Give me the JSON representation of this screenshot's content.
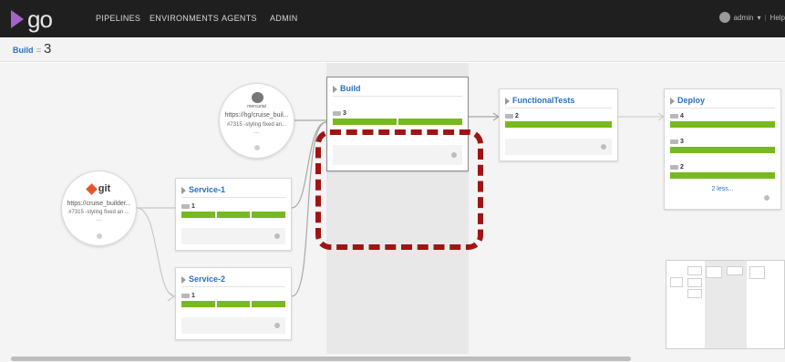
{
  "header": {
    "logo_text": "go",
    "nav": [
      "PIPELINES",
      "ENVIRONMENTS",
      "AGENTS",
      "ADMIN"
    ],
    "user": "admin",
    "user_caret": "▾",
    "separator": "|",
    "help": "Help"
  },
  "breadcrumb": {
    "pipeline": "Build",
    "separator": "=",
    "counter": "3"
  },
  "materials": [
    {
      "id": "git",
      "logo_text": "git",
      "url": "https://cruise_builder...",
      "message": "#7315 -styling fixed an ...",
      "more": "..."
    },
    {
      "id": "hg",
      "logo_text": "mercurial",
      "url": "https://hg/cruise_buil...",
      "message": "#7315 -styling fixed an...",
      "more": "..."
    }
  ],
  "pipelines": [
    {
      "id": "service-1",
      "name": "Service-1",
      "instances": [
        {
          "label": "1",
          "stages": 3
        }
      ]
    },
    {
      "id": "service-2",
      "name": "Service-2",
      "instances": [
        {
          "label": "1",
          "stages": 3
        }
      ]
    },
    {
      "id": "build",
      "name": "Build",
      "instances": [
        {
          "label": "3",
          "stages": 2
        }
      ]
    },
    {
      "id": "functionaltests",
      "name": "FunctionalTests",
      "instances": [
        {
          "label": "2",
          "stages": 1
        }
      ]
    },
    {
      "id": "deploy",
      "name": "Deploy",
      "instances": [
        {
          "label": "4",
          "stages": 1
        },
        {
          "label": "3",
          "stages": 1
        },
        {
          "label": "2",
          "stages": 1
        }
      ],
      "more_label": "2 less..."
    }
  ],
  "colors": {
    "stage_passed": "#77b91e",
    "link": "#2a70c3",
    "highlight": "#a01414",
    "topbar": "#1f1f1f",
    "git": "#e4572e",
    "logo_chevron": "#a463c9"
  }
}
